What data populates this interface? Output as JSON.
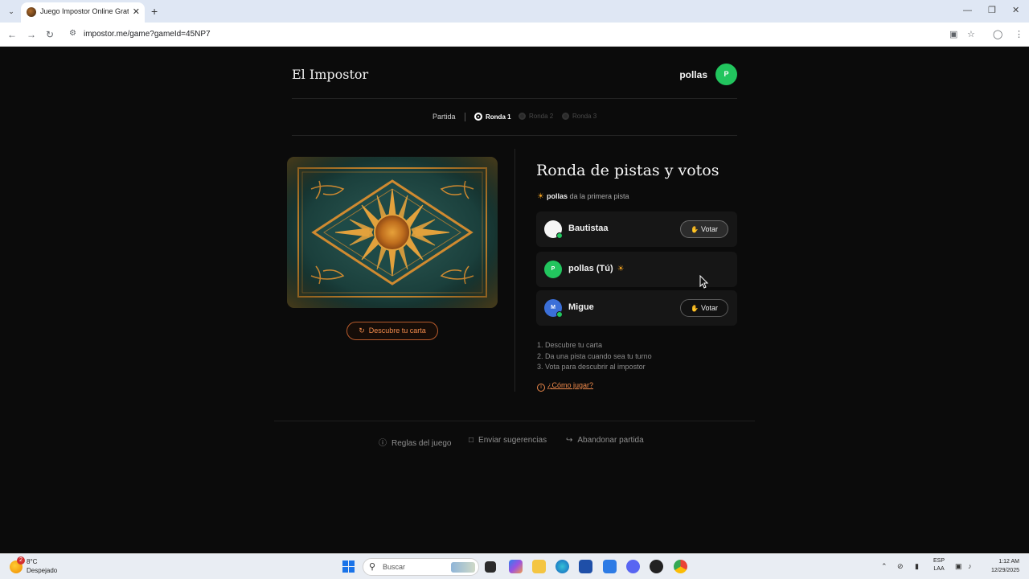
{
  "browser": {
    "tab_title": "Juego Impostor Online Gratis - ",
    "url": "impostor.me/game?gameId=45NP7"
  },
  "header": {
    "brand": "El Impostor",
    "username": "pollas",
    "avatar_letter": "P"
  },
  "stepper": {
    "partida": "Partida",
    "rounds": [
      "Ronda 1",
      "Ronda 2",
      "Ronda 3"
    ]
  },
  "card": {
    "discover_label": "Descubre tu carta"
  },
  "panel": {
    "title": "Ronda de pistas y votos",
    "clue_player": "pollas",
    "clue_text": " da la primera pista",
    "players": [
      {
        "name": "Bautistaa",
        "avatar": "",
        "vote_label": "Votar"
      },
      {
        "name": "pollas (Tú)",
        "avatar": "P"
      },
      {
        "name": "Migue",
        "avatar": "M",
        "vote_label": "Votar"
      }
    ],
    "instructions": [
      "1. Descubre tu carta",
      "2. Da una pista cuando sea tu turno",
      "3. Vota para descubrir al impostor"
    ],
    "how_to": "¿Cómo jugar?"
  },
  "footer": {
    "rules": "Reglas del juego",
    "suggestions": "Enviar sugerencias",
    "leave": "Abandonar partida"
  },
  "taskbar": {
    "temp": "8°C",
    "condition": "Despejado",
    "weather_badge": "2",
    "search_placeholder": "Buscar",
    "lang_1": "ESP",
    "lang_2": "LAA",
    "time": "1:12 AM",
    "date": "12/29/2025"
  },
  "colors": {
    "accent": "#f08a4b",
    "avatar_green": "#22c55e",
    "avatar_blue": "#3b6fd8",
    "background": "#0b0b0b"
  },
  "icons": [
    "tab-favicon",
    "reload-icon",
    "star-icon",
    "sun-icon",
    "hand-icon",
    "info-icon",
    "chat-icon",
    "exit-icon",
    "refresh-icon"
  ]
}
